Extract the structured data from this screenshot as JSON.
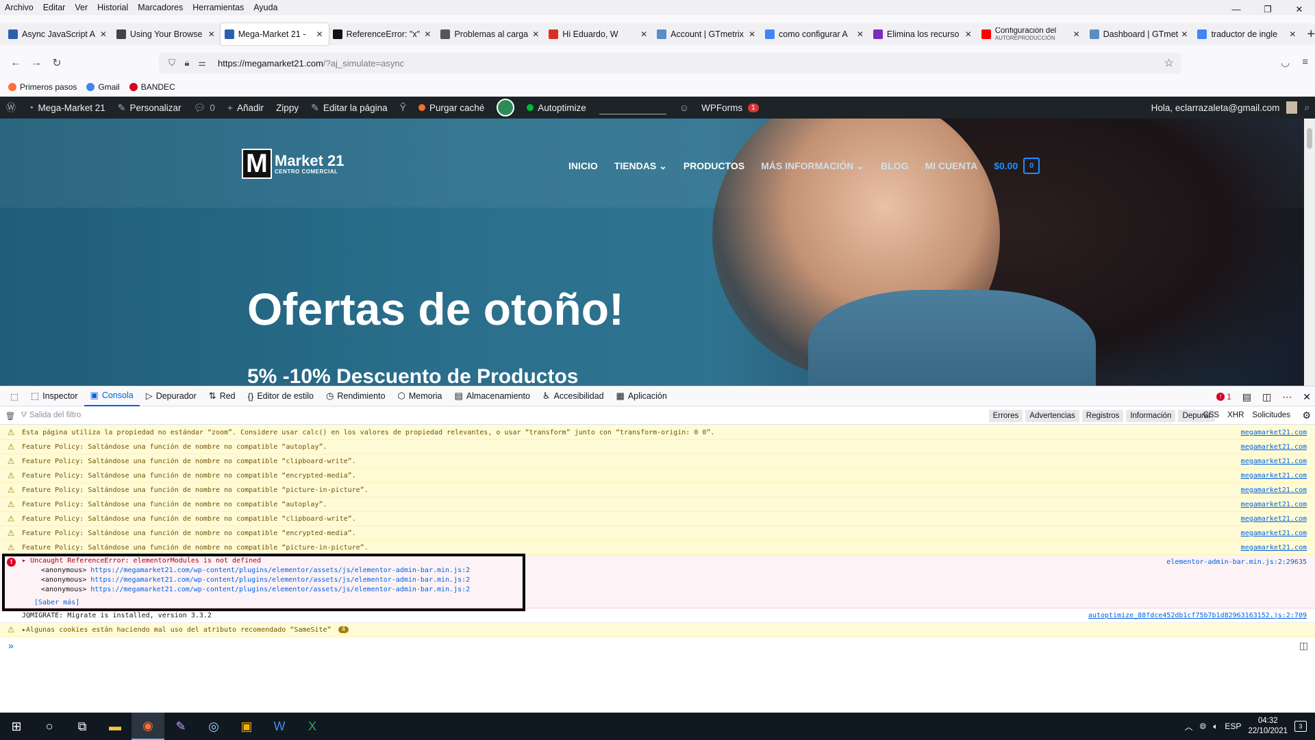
{
  "menubar": [
    "Archivo",
    "Editar",
    "Ver",
    "Historial",
    "Marcadores",
    "Herramientas",
    "Ayuda"
  ],
  "window_controls": [
    "—",
    "❐",
    "✕"
  ],
  "tabs": [
    {
      "title": "Async JavaScript A",
      "icon_color": "#2a5fb0",
      "icon": "doc"
    },
    {
      "title": "Using Your Browse",
      "icon_color": "#464342",
      "icon": "wordpress"
    },
    {
      "title": "Mega-Market 21 -",
      "icon_color": "#2a5fb0",
      "icon": "mega",
      "active": true
    },
    {
      "title": "ReferenceError: \"x\"",
      "icon_color": "#111111",
      "icon": "mdn"
    },
    {
      "title": "Problemas al carga",
      "icon_color": "#555555",
      "icon": "info"
    },
    {
      "title": "Hi Eduardo, W",
      "icon_color": "#d93025",
      "icon": "gmail"
    },
    {
      "title": "Account | GTmetrix",
      "icon_color": "#5a8dc7",
      "icon": "gt"
    },
    {
      "title": "como configurar A",
      "icon_color": "#4285f4",
      "icon": "google"
    },
    {
      "title": "Elimina los recurso",
      "icon_color": "#7b2cbf",
      "icon": "js"
    },
    {
      "title": "Configuración del",
      "icon_color": "#ff0000",
      "icon": "youtube",
      "subtitle": "AUTOREPRODUCCIÓN"
    },
    {
      "title": "Dashboard | GTmet",
      "icon_color": "#5a8dc7",
      "icon": "gt"
    },
    {
      "title": "traductor de ingle",
      "icon_color": "#4285f4",
      "icon": "google"
    }
  ],
  "tab_close": "✕",
  "new_tab": "+",
  "url": {
    "host": "https://megamarket21.com",
    "path": "/?aj_simulate=async"
  },
  "bookmarks": [
    {
      "label": "Primeros pasos",
      "color": "#ff7139"
    },
    {
      "label": "Gmail",
      "color": "#4285f4"
    },
    {
      "label": "BANDEC",
      "color": "#d70022"
    }
  ],
  "wpbar": {
    "site": "Mega-Market 21",
    "customize": "Personalizar",
    "comments": "0",
    "add": "Añadir",
    "zippy": "Zippy",
    "edit_page": "Editar la página",
    "purge": "Purgar caché",
    "autoptimize": "Autoptimize",
    "wpforms": "WPForms",
    "wpforms_count": "1",
    "greeting": "Hola, eclarrazaleta@gmail.com"
  },
  "site": {
    "logo_letter": "M",
    "logo_name": "Market 21",
    "logo_tagline": "CENTRO COMERCIAL",
    "nav": [
      "INICIO",
      "TIENDAS",
      "PRODUCTOS",
      "MÁS INFORMACIÓN",
      "BLOG",
      "MI CUENTA"
    ],
    "cart_total": "$0.00",
    "cart_count": "0",
    "hero_title": "Ofertas de otoño!",
    "hero_subtitle": "5% -10% Descuento de Productos"
  },
  "devtools": {
    "tabs": [
      "Inspector",
      "Consola",
      "Depurador",
      "Red",
      "Editor de estilo",
      "Rendimiento",
      "Memoria",
      "Almacenamiento",
      "Accesibilidad",
      "Aplicación"
    ],
    "active_tab": "Consola",
    "error_count": "1",
    "filter_placeholder": "Salida del filtro",
    "levels": [
      "Errores",
      "Advertencias",
      "Registros",
      "Información",
      "Depurar"
    ],
    "extras": [
      "CSS",
      "XHR",
      "Solicitudes"
    ]
  },
  "console": {
    "warnings": [
      {
        "text": "Esta página utiliza la propiedad no estándar “zoom”. Considere usar calc() en los valores de propiedad relevantes, o usar “transform” junto con “transform-origin: 0 0”.",
        "src": "megamarket21.com"
      },
      {
        "text": "Feature Policy: Saltándose una función de nombre no compatible “autoplay”.",
        "src": "megamarket21.com"
      },
      {
        "text": "Feature Policy: Saltándose una función de nombre no compatible “clipboard-write”.",
        "src": "megamarket21.com"
      },
      {
        "text": "Feature Policy: Saltándose una función de nombre no compatible “encrypted-media”.",
        "src": "megamarket21.com"
      },
      {
        "text": "Feature Policy: Saltándose una función de nombre no compatible “picture-in-picture”.",
        "src": "megamarket21.com"
      },
      {
        "text": "Feature Policy: Saltándose una función de nombre no compatible “autoplay”.",
        "src": "megamarket21.com"
      },
      {
        "text": "Feature Policy: Saltándose una función de nombre no compatible “clipboard-write”.",
        "src": "megamarket21.com"
      },
      {
        "text": "Feature Policy: Saltándose una función de nombre no compatible “encrypted-media”.",
        "src": "megamarket21.com"
      },
      {
        "text": "Feature Policy: Saltándose una función de nombre no compatible “picture-in-picture”.",
        "src": "megamarket21.com"
      }
    ],
    "error": {
      "message": "Uncaught ReferenceError: elementorModules is not defined",
      "src": "elementor-admin-bar.min.js:2:29635",
      "stack_label": "<anonymous>",
      "stack_url": "https://megamarket21.com/wp-content/plugins/elementor/assets/js/elementor-admin-bar.min.js:2",
      "learn_more": "[Saber más]"
    },
    "log": {
      "text": "JQMIGRATE: Migrate is installed, version 3.3.2",
      "src": "autoptimize_88fdce452db1cf75b7b1d82963163152.js:2:709"
    },
    "cookie_warning": {
      "text": "Algunas cookies están haciendo mal uso del atributo recomendado “SameSite”",
      "count": "4"
    }
  },
  "tray": {
    "lang": "ESP",
    "time": "04:32",
    "date": "22/10/2021",
    "notifications": "3"
  }
}
